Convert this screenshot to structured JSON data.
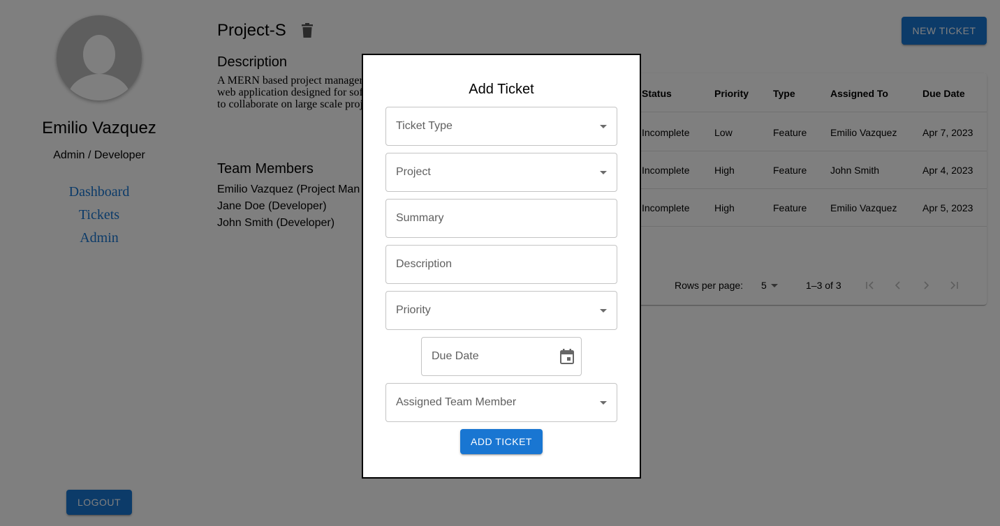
{
  "sidebar": {
    "user_name": "Emilio Vazquez",
    "user_role": "Admin / Developer",
    "nav": [
      {
        "label": "Dashboard"
      },
      {
        "label": "Tickets"
      },
      {
        "label": "Admin"
      }
    ],
    "logout_label": "LOGOUT"
  },
  "project": {
    "title": "Project-S",
    "description_heading": "Description",
    "description_lines": [
      "A MERN based project manager",
      "web application designed for sof",
      "to collaborate on large scale proj"
    ],
    "team_heading": "Team Members",
    "team_members": [
      "Emilio Vazquez (Project Man",
      "Jane Doe (Developer)",
      "John Smith (Developer)"
    ],
    "new_ticket_label": "NEW TICKET"
  },
  "tickets_table": {
    "columns": [
      "Status",
      "Priority",
      "Type",
      "Assigned To",
      "Due Date"
    ],
    "rows": [
      [
        "Incomplete",
        "Low",
        "Feature",
        "Emilio Vazquez",
        "Apr 7, 2023"
      ],
      [
        "Incomplete",
        "High",
        "Feature",
        "John Smith",
        "Apr 4, 2023"
      ],
      [
        "Incomplete",
        "High",
        "Feature",
        "Emilio Vazquez",
        "Apr 5, 2023"
      ]
    ],
    "pagination": {
      "rows_per_page_label": "Rows per page:",
      "rows_per_page_value": "5",
      "range_text": "1–3 of 3"
    }
  },
  "modal": {
    "title": "Add Ticket",
    "fields": {
      "ticket_type": "Ticket Type",
      "project": "Project",
      "summary": "Summary",
      "description": "Description",
      "priority": "Priority",
      "due_date": "Due Date",
      "assigned_team_member": "Assigned Team Member"
    },
    "submit_label": "ADD TICKET"
  },
  "colors": {
    "primary": "#1976d2",
    "backdrop": "rgba(0,0,0,0.5)"
  }
}
